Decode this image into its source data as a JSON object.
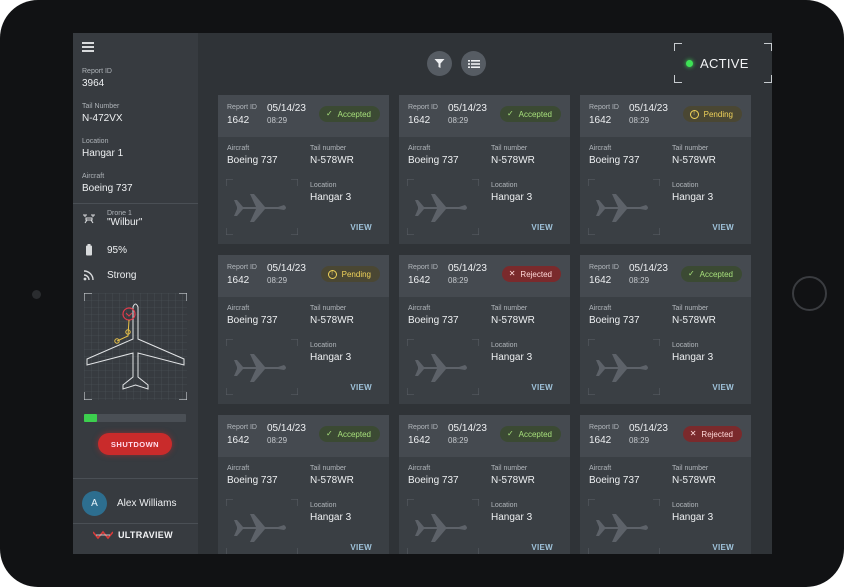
{
  "sidebar": {
    "report_id_label": "Report ID",
    "report_id_value": "3964",
    "tail_number_label": "Tail Number",
    "tail_number_value": "N-472VX",
    "location_label": "Location",
    "location_value": "Hangar 1",
    "aircraft_label": "Aircraft",
    "aircraft_value": "Boeing 737",
    "drone_label": "Drone 1",
    "drone_name": "\"Wilbur\"",
    "battery": "95%",
    "battery_level": 0.13,
    "signal": "Strong",
    "shutdown_label": "SHUTDOWN",
    "user_initial": "A",
    "user_name": "Alex Williams",
    "logo_text": "ULTRAVIEW"
  },
  "header": {
    "status_text": "ACTIVE",
    "status_color": "#3ee356"
  },
  "colors": {
    "accepted": "#a7e07b",
    "pending": "#f0d35a",
    "rejected": "#ffd9d9",
    "accent_link": "#9fc3db"
  },
  "cards": [
    {
      "report_id_label": "Report ID",
      "report_id": "1642",
      "date": "05/14/23",
      "time": "08:29",
      "status": "Accepted",
      "status_key": "accepted",
      "aircraft_label": "Aircraft",
      "aircraft": "Boeing 737",
      "tail_label": "Tail number",
      "tail": "N-578WR",
      "location_label": "Location",
      "location": "Hangar 3",
      "view": "VIEW"
    },
    {
      "report_id_label": "Report ID",
      "report_id": "1642",
      "date": "05/14/23",
      "time": "08:29",
      "status": "Accepted",
      "status_key": "accepted",
      "aircraft_label": "Aircraft",
      "aircraft": "Boeing 737",
      "tail_label": "Tail number",
      "tail": "N-578WR",
      "location_label": "Location",
      "location": "Hangar 3",
      "view": "VIEW"
    },
    {
      "report_id_label": "Report ID",
      "report_id": "1642",
      "date": "05/14/23",
      "time": "08:29",
      "status": "Pending",
      "status_key": "pending",
      "aircraft_label": "Aircraft",
      "aircraft": "Boeing 737",
      "tail_label": "Tail number",
      "tail": "N-578WR",
      "location_label": "Location",
      "location": "Hangar 3",
      "view": "VIEW"
    },
    {
      "report_id_label": "Report ID",
      "report_id": "1642",
      "date": "05/14/23",
      "time": "08:29",
      "status": "Pending",
      "status_key": "pending",
      "aircraft_label": "Aircraft",
      "aircraft": "Boeing 737",
      "tail_label": "Tail number",
      "tail": "N-578WR",
      "location_label": "Location",
      "location": "Hangar 3",
      "view": "VIEW"
    },
    {
      "report_id_label": "Report ID",
      "report_id": "1642",
      "date": "05/14/23",
      "time": "08:29",
      "status": "Rejected",
      "status_key": "rejected",
      "aircraft_label": "Aircraft",
      "aircraft": "Boeing 737",
      "tail_label": "Tail number",
      "tail": "N-578WR",
      "location_label": "Location",
      "location": "Hangar 3",
      "view": "VIEW"
    },
    {
      "report_id_label": "Report ID",
      "report_id": "1642",
      "date": "05/14/23",
      "time": "08:29",
      "status": "Accepted",
      "status_key": "accepted",
      "aircraft_label": "Aircraft",
      "aircraft": "Boeing 737",
      "tail_label": "Tail number",
      "tail": "N-578WR",
      "location_label": "Location",
      "location": "Hangar 3",
      "view": "VIEW"
    },
    {
      "report_id_label": "Report ID",
      "report_id": "1642",
      "date": "05/14/23",
      "time": "08:29",
      "status": "Accepted",
      "status_key": "accepted",
      "aircraft_label": "Aircraft",
      "aircraft": "Boeing 737",
      "tail_label": "Tail number",
      "tail": "N-578WR",
      "location_label": "Location",
      "location": "Hangar 3",
      "view": "VIEW"
    },
    {
      "report_id_label": "Report ID",
      "report_id": "1642",
      "date": "05/14/23",
      "time": "08:29",
      "status": "Accepted",
      "status_key": "accepted",
      "aircraft_label": "Aircraft",
      "aircraft": "Boeing 737",
      "tail_label": "Tail number",
      "tail": "N-578WR",
      "location_label": "Location",
      "location": "Hangar 3",
      "view": "VIEW"
    },
    {
      "report_id_label": "Report ID",
      "report_id": "1642",
      "date": "05/14/23",
      "time": "08:29",
      "status": "Rejected",
      "status_key": "rejected",
      "aircraft_label": "Aircraft",
      "aircraft": "Boeing 737",
      "tail_label": "Tail number",
      "tail": "N-578WR",
      "location_label": "Location",
      "location": "Hangar 3",
      "view": "VIEW"
    }
  ]
}
